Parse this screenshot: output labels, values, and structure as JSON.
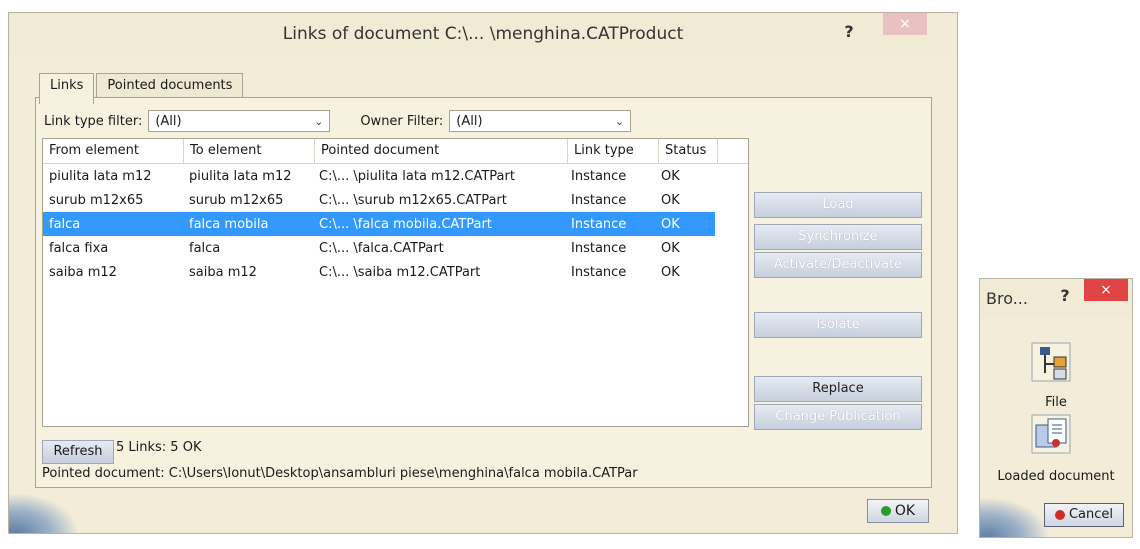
{
  "main_dialog": {
    "title": "Links of document C:\\... \\menghina.CATProduct",
    "help": "?",
    "close": "×",
    "tabs": [
      {
        "label": "Links"
      },
      {
        "label": "Pointed documents"
      }
    ],
    "filters": {
      "link_type_label": "Link type filter:",
      "link_type_value": "(All)",
      "owner_label": "Owner Filter:",
      "owner_value": "(All)"
    },
    "table": {
      "headers": [
        "From element",
        "To element",
        "Pointed document",
        "Link type",
        "Status"
      ],
      "rows": [
        [
          "piulita lata m12",
          "piulita lata m12",
          "C:\\... \\piulita lata m12.CATPart",
          "Instance",
          "OK"
        ],
        [
          "surub m12x65",
          "surub m12x65",
          "C:\\... \\surub m12x65.CATPart",
          "Instance",
          "OK"
        ],
        [
          "falca",
          "falca mobila",
          "C:\\... \\falca mobila.CATPart",
          "Instance",
          "OK"
        ],
        [
          "falca fixa",
          "falca",
          "C:\\... \\falca.CATPart",
          "Instance",
          "OK"
        ],
        [
          "saiba m12",
          "saiba m12",
          "C:\\... \\saiba m12.CATPart",
          "Instance",
          "OK"
        ]
      ],
      "selected_index": 2
    },
    "side_buttons": {
      "load": "Load",
      "synchronize": "Synchronize",
      "activate": "Activate/Deactivate",
      "isolate": "Isolate",
      "replace": "Replace",
      "change_publication": "Change Publication"
    },
    "refresh_label": "Refresh",
    "summary": "5 Links: 5 OK",
    "pointed_document": "Pointed document: C:\\Users\\Ionut\\Desktop\\ansambluri piese\\menghina\\falca mobila.CATPar",
    "ok_label": "OK"
  },
  "browse_dialog": {
    "title": "Bro...",
    "help": "?",
    "close": "×",
    "file_label": "File",
    "loaded_label": "Loaded document",
    "cancel_label": "Cancel"
  },
  "colors": {
    "selection": "#3399ff",
    "dialog_bg": "#f3ecd8",
    "close_red": "#e04343"
  }
}
